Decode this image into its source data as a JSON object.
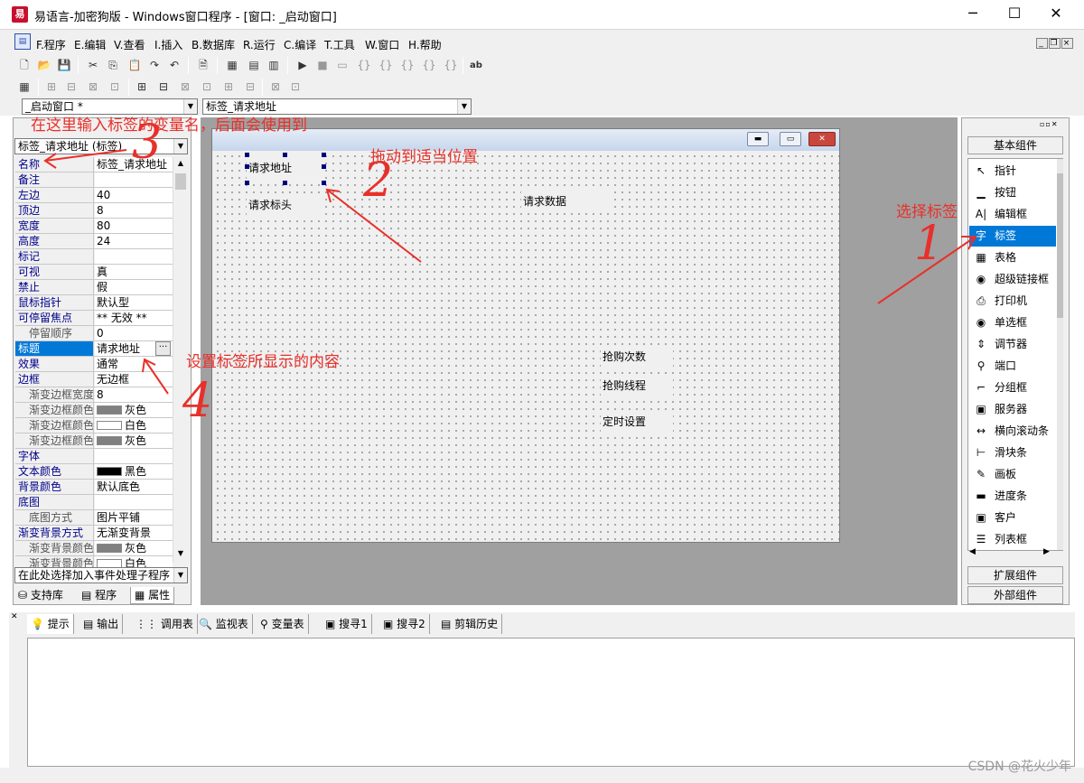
{
  "window": {
    "title": "易语言-加密狗版 - Windows窗口程序 - [窗口: _启动窗口]",
    "app_icon": "易",
    "controls": {
      "minimize": "─",
      "maximize": "☐",
      "close": "✕"
    }
  },
  "menu": [
    "F.程序",
    "E.编辑",
    "V.查看",
    "I.插入",
    "B.数据库",
    "R.运行",
    "C.编译",
    "T.工具",
    "W.窗口",
    "H.帮助"
  ],
  "mdi": {
    "min": "_",
    "restore": "❐",
    "close": "×"
  },
  "toolbar1": [
    "🗋",
    "📂",
    "💾",
    "✂",
    "⎘",
    "📋",
    "↷",
    "↶",
    "🗎",
    "▦",
    "▤",
    "▥",
    "▶",
    "■",
    "▭",
    "{}",
    "{}",
    "{}",
    "{}",
    "{}",
    "ab"
  ],
  "toolbar2": [
    "▦",
    "⊞",
    "⊟",
    "⊠",
    "⊡",
    "⊞",
    "⊟",
    "⊠",
    "⊡",
    "⊞",
    "⊟",
    "⊠",
    "⊡"
  ],
  "combo": {
    "window_select": "_启动窗口 *",
    "control_select": "标签_请求地址"
  },
  "left": {
    "object_select": "标签_请求地址 (标签)",
    "properties": [
      {
        "name": "名称",
        "value": "标签_请求地址",
        "sub": false
      },
      {
        "name": "备注",
        "value": "",
        "sub": false
      },
      {
        "name": "左边",
        "value": "40",
        "sub": false
      },
      {
        "name": "顶边",
        "value": "8",
        "sub": false
      },
      {
        "name": "宽度",
        "value": "80",
        "sub": false
      },
      {
        "name": "高度",
        "value": "24",
        "sub": false
      },
      {
        "name": "标记",
        "value": "",
        "sub": false
      },
      {
        "name": "可视",
        "value": "真",
        "sub": false
      },
      {
        "name": "禁止",
        "value": "假",
        "sub": false
      },
      {
        "name": "鼠标指针",
        "value": "默认型",
        "sub": false
      },
      {
        "name": "可停留焦点",
        "value": "** 无效 **",
        "sub": false
      },
      {
        "name": "停留顺序",
        "value": "0",
        "sub": true
      },
      {
        "name": "标题",
        "value": "请求地址",
        "sub": false
      },
      {
        "name": "效果",
        "value": "通常",
        "sub": false
      },
      {
        "name": "边框",
        "value": "无边框",
        "sub": false
      },
      {
        "name": "渐变边框宽度",
        "value": "8",
        "sub": true
      },
      {
        "name": "渐变边框颜色",
        "value": "灰色",
        "sub": true,
        "swatch": "#808080"
      },
      {
        "name": "渐变边框颜色",
        "value": "白色",
        "sub": true,
        "swatch": "#ffffff"
      },
      {
        "name": "渐变边框颜色",
        "value": "灰色",
        "sub": true,
        "swatch": "#808080"
      },
      {
        "name": "字体",
        "value": "",
        "sub": false
      },
      {
        "name": "文本颜色",
        "value": "黑色",
        "sub": false,
        "swatch": "#000000"
      },
      {
        "name": "背景颜色",
        "value": "默认底色",
        "sub": false
      },
      {
        "name": "底图",
        "value": "",
        "sub": false
      },
      {
        "name": "底图方式",
        "value": "图片平铺",
        "sub": true
      },
      {
        "name": "渐变背景方式",
        "value": "无渐变背景",
        "sub": false
      },
      {
        "name": "渐变背景颜色",
        "value": "灰色",
        "sub": true,
        "swatch": "#808080"
      },
      {
        "name": "渐变背景颜色",
        "value": "白色",
        "sub": true,
        "swatch": "#ffffff"
      }
    ],
    "selected_property": "标题",
    "event_select": "在此处选择加入事件处理子程序",
    "tabs": [
      "支持库",
      "程序",
      "属性"
    ]
  },
  "form": {
    "labels": [
      {
        "text": "请求地址"
      },
      {
        "text": "请求标头"
      },
      {
        "text": "请求数据"
      },
      {
        "text": "抢购次数"
      },
      {
        "text": "抢购线程"
      },
      {
        "text": "定时设置"
      }
    ],
    "caption_buttons": {
      "min": "▬",
      "max": "▭",
      "close": "✕"
    }
  },
  "components": {
    "header_basic": "基本组件",
    "items": [
      {
        "icon": "↖",
        "label": "指针"
      },
      {
        "icon": "▁",
        "label": "按钮"
      },
      {
        "icon": "A|",
        "label": "编辑框"
      },
      {
        "icon": "字",
        "label": "标签"
      },
      {
        "icon": "▦",
        "label": "表格"
      },
      {
        "icon": "◉",
        "label": "超级链接框"
      },
      {
        "icon": "⎙",
        "label": "打印机"
      },
      {
        "icon": "◉",
        "label": "单选框"
      },
      {
        "icon": "⇕",
        "label": "调节器"
      },
      {
        "icon": "⚲",
        "label": "端口"
      },
      {
        "icon": "⌐",
        "label": "分组框"
      },
      {
        "icon": "▣",
        "label": "服务器"
      },
      {
        "icon": "↔",
        "label": "横向滚动条"
      },
      {
        "icon": "⊢",
        "label": "滑块条"
      },
      {
        "icon": "✎",
        "label": "画板"
      },
      {
        "icon": "▬",
        "label": "进度条"
      },
      {
        "icon": "▣",
        "label": "客户"
      },
      {
        "icon": "☰",
        "label": "列表框"
      }
    ],
    "selected": "标签",
    "header_ext": "扩展组件",
    "header_ext2": "外部组件"
  },
  "bottom_tabs": [
    "提示",
    "输出",
    "调用表",
    "监视表",
    "变量表",
    "搜寻1",
    "搜寻2",
    "剪辑历史"
  ],
  "annotations": {
    "a1": "选择标签",
    "a2": "拖动到适当位置",
    "a3": "在这里输入标签的变量名，后面会使用到",
    "a4": "设置标签所显示的内容",
    "n1": "1",
    "n2": "2",
    "n3": "3",
    "n4": "4"
  },
  "watermark": "CSDN @花火少年",
  "colors": {
    "accent": "#0078d7",
    "annotation": "#e8302a"
  }
}
